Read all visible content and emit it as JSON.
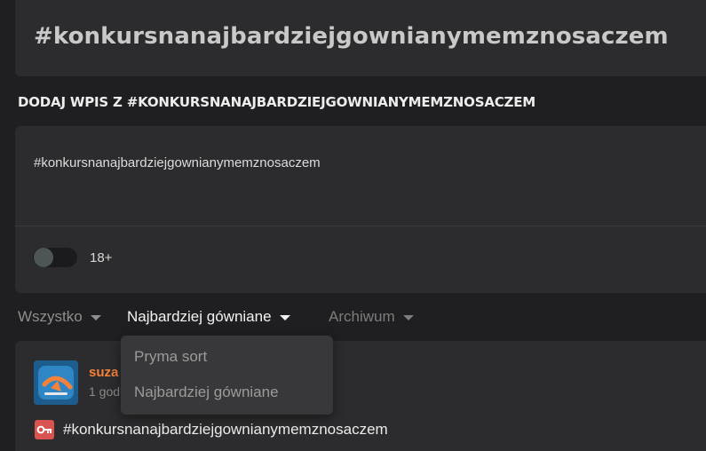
{
  "tag_header": {
    "title": "#konkursnanajbardziejgownianymemznosaczem"
  },
  "composer": {
    "heading": "DODAJ WPIS Z #KONKURSNANAJBARDZIEJGOWNIANYMEMZNOSACZEM",
    "text_value": "#konkursnanajbardziejgownianymemznosaczem",
    "adult_toggle_label": "18+",
    "adult_toggle_on": false
  },
  "sort": {
    "tabs": [
      {
        "label": "Wszystko"
      },
      {
        "label": "Najbardziej gówniane",
        "active": true
      },
      {
        "label": "Archiwum"
      }
    ],
    "dropdown_options": [
      "Pryma sort",
      "Najbardziej gówniane"
    ]
  },
  "entry": {
    "author": "suza",
    "time": "1 god",
    "tag": "#konkursnanajbardziejgownianymemznosaczem",
    "badge_icon": "key-icon"
  },
  "colors": {
    "background": "#1f1f21",
    "panel": "#2c2c2e",
    "author": "#f5823a",
    "badge": "#d9534f",
    "avatar_bg": "#1c5d8e"
  }
}
